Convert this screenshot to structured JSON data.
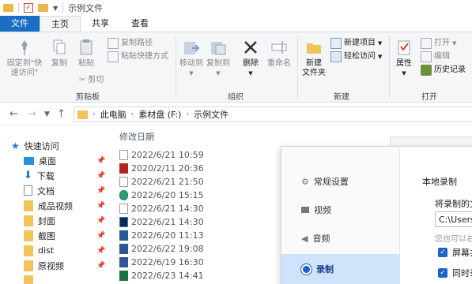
{
  "window": {
    "title": "示例文件"
  },
  "tabs": [
    "文件",
    "主页",
    "共享",
    "查看"
  ],
  "ribbon": {
    "clipboard": {
      "pin_label_1": "固定到\"快",
      "pin_label_2": "速访问\"",
      "copy": "复制",
      "paste": "粘贴",
      "copy_path": "复制路径",
      "paste_shortcut": "粘贴快捷方式",
      "cut": "剪切",
      "group": "剪贴板"
    },
    "organize": {
      "move_to": "移动到",
      "copy_to": "复制到",
      "delete": "删除",
      "rename": "重命名",
      "group": "组织"
    },
    "new": {
      "new_folder_1": "新建",
      "new_folder_2": "文件夹",
      "new_item": "新建项目",
      "easy_access": "轻松访问",
      "group": "新建"
    },
    "open": {
      "properties": "属性",
      "open": "打开",
      "edit": "编辑",
      "history": "历史记录",
      "group": "打开"
    }
  },
  "address": {
    "crumbs": [
      "此电脑",
      "素材盘 (F:)",
      "示例文件"
    ]
  },
  "sidebar": {
    "items": [
      {
        "label": "快速访问",
        "pinned": false
      },
      {
        "label": "桌面",
        "pinned": true
      },
      {
        "label": "下载",
        "pinned": true
      },
      {
        "label": "文档",
        "pinned": true
      },
      {
        "label": "成品视频",
        "pinned": true
      },
      {
        "label": "封面",
        "pinned": true
      },
      {
        "label": "截图",
        "pinned": true
      },
      {
        "label": "dist",
        "pinned": true
      },
      {
        "label": "原视频",
        "pinned": true
      }
    ]
  },
  "filelist": {
    "column_modified": "修改日期",
    "rows": [
      {
        "date": "2022/6/21 10:59",
        "icon": "document-icon"
      },
      {
        "date": "2020/2/11 20:36",
        "icon": "pdf-icon"
      },
      {
        "date": "2022/6/21 21:50",
        "icon": "document-icon"
      },
      {
        "date": "2022/6/20 15:15",
        "icon": "edge-icon"
      },
      {
        "date": "2022/6/21 14:30",
        "icon": "document-icon"
      },
      {
        "date": "2022/6/21 14:30",
        "icon": "photoshop-icon"
      },
      {
        "date": "2022/6/20 11:13",
        "icon": "word-icon"
      },
      {
        "date": "2022/6/22 19:08",
        "icon": "word-icon"
      },
      {
        "date": "2022/6/19 16:30",
        "icon": "word-icon"
      },
      {
        "date": "2022/6/23 14:41",
        "icon": "excel-icon"
      }
    ]
  },
  "dialog": {
    "menu": [
      "常规设置",
      "视频",
      "音频",
      "录制"
    ],
    "section_title": "本地录制",
    "save_label": "将录制的文",
    "path_value": "C:\\Users",
    "hint": "您也可以右",
    "check1": "屏幕共",
    "check2": "同时录"
  },
  "colors": {
    "accent": "#1a6fc4",
    "selected": "#cfe3fb",
    "folder": "#f0c35b"
  }
}
